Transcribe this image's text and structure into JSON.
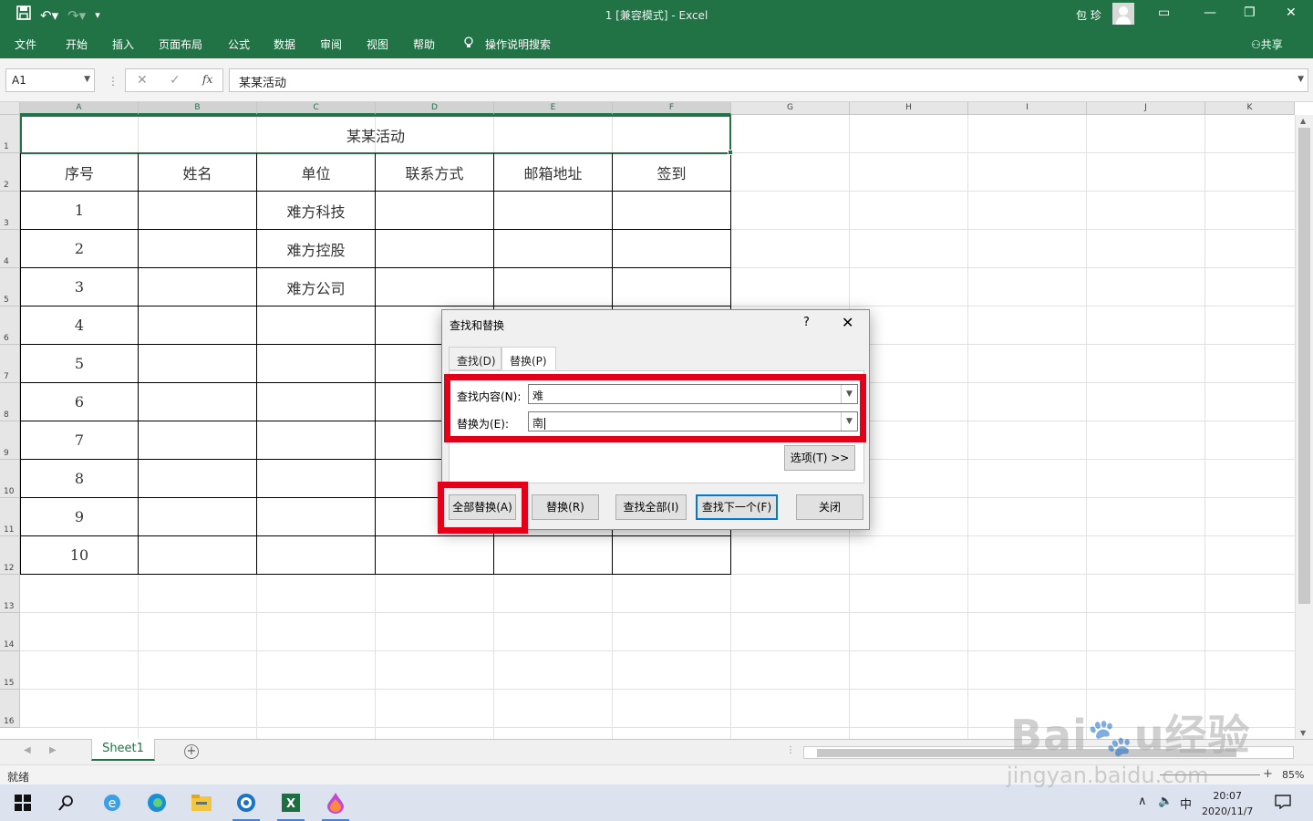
{
  "titlebar": {
    "title": "1  [兼容模式]  -  Excel",
    "user": "包 珍"
  },
  "menu": [
    "文件",
    "开始",
    "插入",
    "页面布局",
    "公式",
    "数据",
    "审阅",
    "视图",
    "帮助",
    "操作说明搜索"
  ],
  "share_label": "共享",
  "formula_bar": {
    "name_box": "A1",
    "formula": "某某活动",
    "fx": "fx"
  },
  "columns": [
    "A",
    "B",
    "C",
    "D",
    "E",
    "F",
    "G",
    "H",
    "I",
    "J",
    "K"
  ],
  "rows": [
    "1",
    "2",
    "3",
    "4",
    "5",
    "6",
    "7",
    "8",
    "9",
    "10",
    "11",
    "12",
    "13",
    "14",
    "15",
    "16"
  ],
  "sheet": {
    "title": "某某活动",
    "headers": [
      "序号",
      "姓名",
      "单位",
      "联系方式",
      "邮箱地址",
      "签到"
    ],
    "data": [
      [
        "1",
        "",
        "难方科技",
        "",
        "",
        ""
      ],
      [
        "2",
        "",
        "难方控股",
        "",
        "",
        ""
      ],
      [
        "3",
        "",
        "难方公司",
        "",
        "",
        ""
      ],
      [
        "4",
        "",
        "",
        "",
        "",
        ""
      ],
      [
        "5",
        "",
        "",
        "",
        "",
        ""
      ],
      [
        "6",
        "",
        "",
        "",
        "",
        ""
      ],
      [
        "7",
        "",
        "",
        "",
        "",
        ""
      ],
      [
        "8",
        "",
        "",
        "",
        "",
        ""
      ],
      [
        "9",
        "",
        "",
        "",
        "",
        ""
      ],
      [
        "10",
        "",
        "",
        "",
        "",
        ""
      ]
    ]
  },
  "sheet_tab": "Sheet1",
  "status": {
    "ready": "就绪",
    "zoom": "85%"
  },
  "dialog": {
    "title": "查找和替换",
    "help": "?",
    "tabs": [
      "查找(D)",
      "替换(P)"
    ],
    "find_label": "查找内容(N):",
    "find_value": "难",
    "replace_label": "替换为(E):",
    "replace_value": "南",
    "options_button": "选项(T) >>",
    "buttons": [
      "全部替换(A)",
      "替换(R)",
      "查找全部(I)",
      "查找下一个(F)",
      "关闭"
    ]
  },
  "clock": {
    "time": "20:07",
    "date": "2020/11/7"
  },
  "ime": "中",
  "watermark": {
    "brand": "Baidu经验",
    "url": "jingyan.baidu.com"
  },
  "colors": {
    "excel_green": "#217346",
    "highlight_red": "#e5001a",
    "focus_blue": "#0078d7"
  }
}
